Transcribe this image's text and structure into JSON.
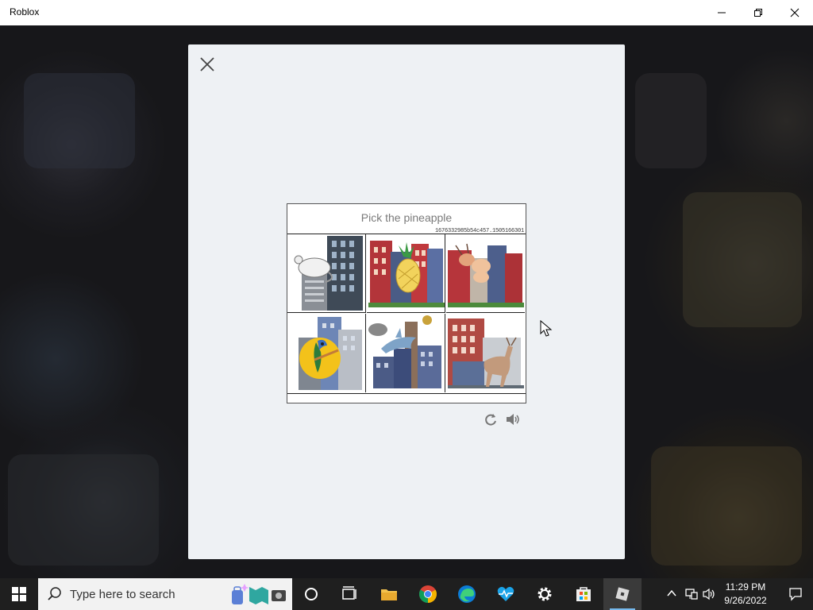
{
  "window": {
    "title": "Roblox",
    "controls": [
      "minimize",
      "maximize",
      "close"
    ]
  },
  "captcha": {
    "prompt": "Pick the pineapple",
    "session_id": "1676332985b54c457.1505166301",
    "tiles": [
      {
        "subject": "mouse",
        "label": "mouse-tile"
      },
      {
        "subject": "pineapple",
        "label": "pineapple-tile"
      },
      {
        "subject": "ant",
        "label": "ant-tile"
      },
      {
        "subject": "parrot",
        "label": "parrot-tile"
      },
      {
        "subject": "dolphin",
        "label": "dolphin-tile"
      },
      {
        "subject": "deer",
        "label": "deer-tile"
      }
    ],
    "controls": {
      "refresh_icon": "refresh-icon",
      "audio_icon": "speaker-icon"
    }
  },
  "taskbar": {
    "search_placeholder": "Type here to search",
    "pinned": [
      "cortana-icon",
      "task-view-icon",
      "file-explorer-icon",
      "chrome-icon",
      "edge-icon",
      "health-app-icon",
      "settings-icon",
      "microsoft-store-icon",
      "roblox-icon"
    ],
    "clock": {
      "time": "11:29 PM",
      "date": "9/26/2022"
    }
  },
  "colors": {
    "modal_bg": "#eef1f4",
    "taskbar_bg": "#1f1f1f",
    "accent": "#76b9ed"
  }
}
